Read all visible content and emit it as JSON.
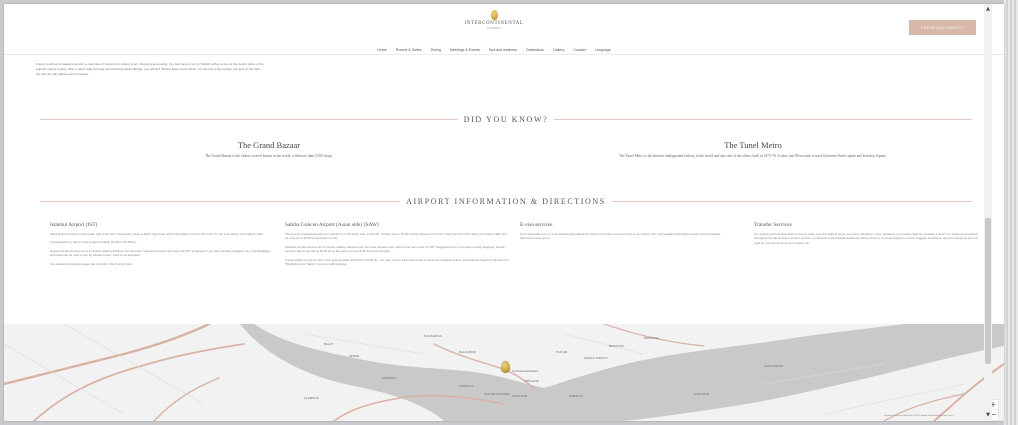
{
  "header": {
    "logo_text": "INTERCONTINENTAL",
    "logo_sub": "ISTANBUL",
    "cta_label": "CHECK AVAILABILITY",
    "nav": [
      "Home",
      "Rooms & Suites",
      "Dining",
      "Meetings & Events",
      "Spa and wellness",
      "Destination",
      "Gallery",
      "Contact",
      "Language"
    ]
  },
  "intro_text": "Freely reaching to Galata's summit, a new face of Istanbul for culture & art, shopping and eating. You can have a cup of Turkish coffee at one of the trendy cafes or the popular streets nearby. After a short walk crossing the historical Galata Bridge, you will find \"Where East meets West\". On the left, a big modern city and on the right, the old city with palaces and mosques.",
  "did_you_know": {
    "title": "DID YOU KNOW?",
    "facts": [
      {
        "title": "The Grand Bazaar",
        "text": "The Grand Bazaar is the oldest covered bazaar in the world, with more than 3,500 shops."
      },
      {
        "title": "The Tunel Metro",
        "text": "The Tunel Metro is the shortest underground railway in the world and also one of the oldest, built in 1875-78. It takes just 80 seconds to travel between Tunel square and Karakoy Square."
      }
    ]
  },
  "airport": {
    "title": "AIRPORT INFORMATION & DIRECTIONS",
    "columns": [
      {
        "title": "Istanbul Airport (IST)",
        "p1": "Istanbul New Airport is in European side of the city in Arnavutkoy close to Black Sea coast. All the IGA flights now from the hotel. It's the main airport since March 2019.",
        "p2": "Transportation by airport cabs is approximately 35-300 in 35-50min.",
        "p3": "Havaist shuttle services are 2-3 minutes walking distance from the hotel, operates 24 hours and costs 18 TRY. Suggested if you have possibly baggage only a handbaggage and cards can be used to pay for Havaist buses. Cash is not accepted.",
        "p4": "For detailed information please call +90 444 1 442 (1-442) (IGA)"
      },
      {
        "title": "Sabiha Gokcen Airport (Asian side) (SAW)",
        "p1": "The second international airport in Istanbul is on the Asian side, in Pendik - Kurtkoy and is 75-90 minutes distance to the (IC) hotel from the hotel. Away from heavy traffic and as close as to 35-50 transportation to city.",
        "p2": "Havabus shuttle services are 5 minutes walking distance from the hotel; departs every half an hour and costs 18 TRY. Suggested only if you have possibly baggage. Shuttle services start to operate at 04:00 am in the early morning till 01:00 am at midnight.",
        "p3": "Transportation by airport cabs costs approximately 90-120Tl in 35-50min. You may need to travel connected to tunnel from Sabiha Gokcen International Airport by following the \"Beylikduzu and Taksim\" signs on E-80 highway.",
        "p4": ""
      },
      {
        "title": "E-visa services",
        "p1": "If it is applicable it is our understanding that allows the citizens of certain countries entry to our country. For more detailed information please visit the website: http://www.evisa.gov.tr/",
        "p2": "",
        "p3": "",
        "p4": ""
      },
      {
        "title": "Transfer Services",
        "p1": "Our airport guest services team is here to make your first night at home, and enjoy travelling in style. Whatever your needs might be, consider it done! You will be accompanied throughout the whole airport service process, be assured of all possible assistance during check-in, personal passport control, baggage assistance, duty-free shopping and any night up until you arrive at your transfer car.",
        "p2": "",
        "p3": "",
        "p4": ""
      }
    ]
  },
  "map": {
    "labels": [
      "BALKAPANI",
      "EMINONU",
      "ALEMDAR",
      "TAKSIM",
      "KASIMPASA",
      "KARAKOY",
      "TOPHANE",
      "TAKSIM SQUARE",
      "CIHANGIR",
      "KABATAS",
      "BESIKTAS",
      "BESIKTAS",
      "USKUDAR",
      "BALAT",
      "FENER",
      "ASMALI MESCIT",
      "KUZGUNCUK"
    ],
    "pin_label": "InterContinental Istanbul",
    "zoom_in": "+",
    "zoom_out": "−",
    "attribution": "Keyboard shortcuts  Map data ©2023 Google  Terms  Report a map error",
    "colors": {
      "water": "#c9c9c9",
      "land": "#f2f2f2",
      "roads": "#d8b3a5"
    }
  },
  "scrollbar": {
    "up": "▲",
    "down": "▼"
  }
}
